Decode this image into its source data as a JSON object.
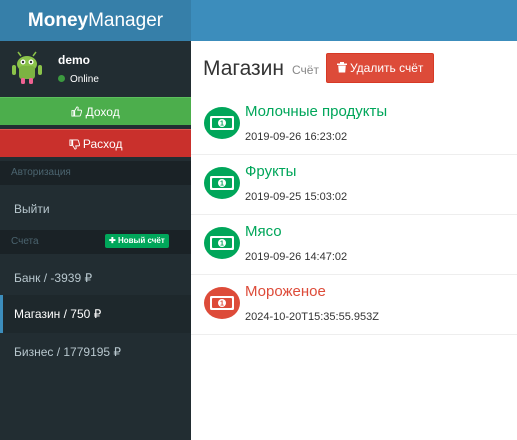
{
  "app": {
    "logo_bold": "Money",
    "logo_light": "Manager"
  },
  "user": {
    "name": "demo",
    "status": "Online"
  },
  "sidebar": {
    "income_label": "Доход",
    "expense_label": "Расход",
    "auth_header": "Авторизация",
    "logout_label": "Выйти",
    "accounts_header": "Счета",
    "new_account_label": "Новый счёт",
    "accounts": [
      {
        "label": "Банк / -3939 ₽"
      },
      {
        "label": "Магазин / 750 ₽"
      },
      {
        "label": "Бизнес / 1779195 ₽"
      }
    ]
  },
  "main": {
    "title": "Магазин",
    "subtitle": "Счёт",
    "delete_label": "Удалить счёт",
    "transactions": [
      {
        "title": "Молочные продукты",
        "date": "2019-09-26 16:23:02",
        "type": "income"
      },
      {
        "title": "Фрукты",
        "date": "2019-09-25 15:03:02",
        "type": "income"
      },
      {
        "title": "Мясо",
        "date": "2019-09-26 14:47:02",
        "type": "income"
      },
      {
        "title": "Мороженое",
        "date": "2024-10-20T15:35:55.953Z",
        "type": "expense"
      }
    ]
  },
  "colors": {
    "brand": "#3c8dbc",
    "income": "#00a65a",
    "expense": "#dd4b39"
  }
}
